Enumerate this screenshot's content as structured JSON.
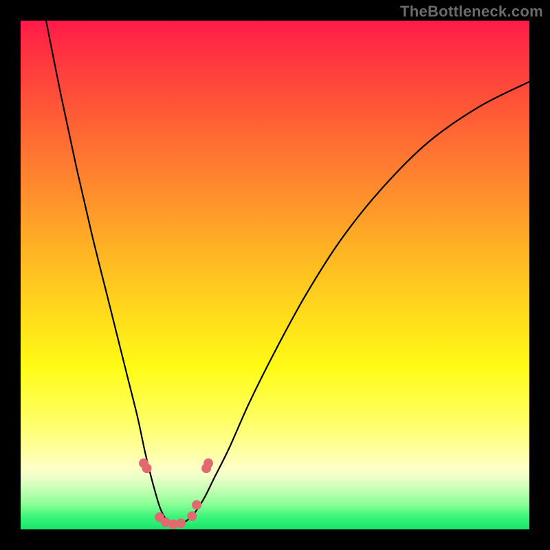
{
  "watermark": "TheBottleneck.com",
  "colors": {
    "curve": "#000000",
    "marker": "#e06a6f",
    "frame_bg": "#000000"
  },
  "chart_data": {
    "type": "line",
    "title": "",
    "xlabel": "",
    "ylabel": "",
    "xlim": [
      0,
      100
    ],
    "ylim": [
      0,
      100
    ],
    "curve": {
      "x": [
        5,
        8,
        11,
        14,
        17,
        19,
        21,
        23,
        24.5,
        26,
        27.5,
        29,
        30.5,
        32,
        34,
        36,
        38,
        41,
        45,
        50,
        56,
        63,
        71,
        80,
        90,
        100
      ],
      "y": [
        100,
        85,
        71,
        58,
        46,
        38,
        30,
        22,
        15,
        9,
        4,
        1.5,
        1,
        1.3,
        3,
        6,
        10,
        16,
        25,
        35,
        46,
        57,
        67,
        76,
        83,
        88
      ]
    },
    "markers": [
      {
        "x": 24.2,
        "y": 13
      },
      {
        "x": 24.8,
        "y": 12
      },
      {
        "x": 27.3,
        "y": 2.4
      },
      {
        "x": 28.5,
        "y": 1.4
      },
      {
        "x": 30.0,
        "y": 1.0
      },
      {
        "x": 31.5,
        "y": 1.2
      },
      {
        "x": 33.7,
        "y": 2.6
      },
      {
        "x": 34.6,
        "y": 4.8
      },
      {
        "x": 36.5,
        "y": 12
      },
      {
        "x": 36.9,
        "y": 13
      }
    ]
  }
}
